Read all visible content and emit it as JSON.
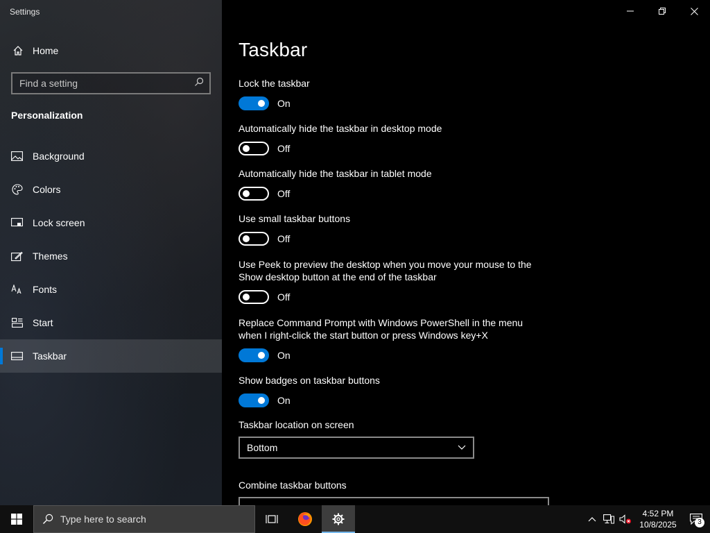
{
  "window": {
    "title": "Settings"
  },
  "sidebar": {
    "home_label": "Home",
    "search_placeholder": "Find a setting",
    "section_title": "Personalization",
    "items": [
      {
        "label": "Background",
        "icon": "image-icon"
      },
      {
        "label": "Colors",
        "icon": "palette-icon"
      },
      {
        "label": "Lock screen",
        "icon": "lock-screen-icon"
      },
      {
        "label": "Themes",
        "icon": "themes-icon"
      },
      {
        "label": "Fonts",
        "icon": "fonts-icon"
      },
      {
        "label": "Start",
        "icon": "start-icon"
      },
      {
        "label": "Taskbar",
        "icon": "taskbar-icon",
        "active": true
      }
    ]
  },
  "main": {
    "title": "Taskbar",
    "settings": [
      {
        "label": "Lock the taskbar",
        "state": "On"
      },
      {
        "label": "Automatically hide the taskbar in desktop mode",
        "state": "Off"
      },
      {
        "label": "Automatically hide the taskbar in tablet mode",
        "state": "Off"
      },
      {
        "label": "Use small taskbar buttons",
        "state": "Off"
      },
      {
        "label": "Use Peek to preview the desktop when you move your mouse to the Show desktop button at the end of the taskbar",
        "state": "Off"
      },
      {
        "label": "Replace Command Prompt with Windows PowerShell in the menu when I right-click the start button or press Windows key+X",
        "state": "On"
      },
      {
        "label": "Show badges on taskbar buttons",
        "state": "On"
      }
    ],
    "location_label": "Taskbar location on screen",
    "location_value": "Bottom",
    "combine_label": "Combine taskbar buttons"
  },
  "taskbar": {
    "search_placeholder": "Type here to search",
    "time": "4:52 PM",
    "date": "10/8/2025",
    "notification_count": "3"
  },
  "colors": {
    "accent": "#0078d7"
  }
}
